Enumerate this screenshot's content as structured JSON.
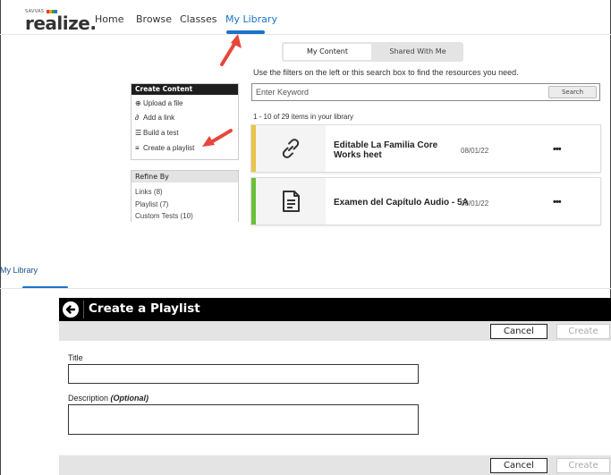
{
  "topnav": {
    "logo_small": "SAVVAS",
    "logo": "realize.",
    "items": [
      "Home",
      "Browse",
      "Classes",
      "My Library"
    ],
    "active": "My Library"
  },
  "content_tabs": [
    "My Content",
    "Shared With Me"
  ],
  "hint": "Use the filters on the left or this search box to find the resources you need.",
  "search": {
    "placeholder": "Enter Keyword",
    "button": "Search"
  },
  "result_count": "1 - 10 of 29 items in your library",
  "items": [
    {
      "title": "Editable La Familia Core Works heet",
      "date": "08/01/22",
      "more": "•••",
      "icon": "link-icon",
      "color": "#e8c547"
    },
    {
      "title": "Examen del Capítulo Audio - 5A",
      "date": "08/01/22",
      "more": "•••",
      "icon": "document-icon",
      "color": "#6cbf3a"
    }
  ],
  "create_content": {
    "header": "Create Content",
    "items": [
      {
        "label": "Upload a file",
        "icon": "upload-icon"
      },
      {
        "label": "Add a link",
        "icon": "link-icon"
      },
      {
        "label": "Build a test",
        "icon": "test-icon"
      },
      {
        "label": "Create a playlist",
        "icon": "playlist-icon"
      }
    ]
  },
  "refine": {
    "header": "Refine By",
    "items": [
      "Links (8)",
      "Playlist (7)",
      "Custom Tests (10)"
    ]
  },
  "bottom": {
    "tab": "My Library",
    "modal_title": "Create a Playlist",
    "cancel": "Cancel",
    "create": "Create",
    "title_label": "Title",
    "description_label": "Description",
    "optional": "(Optional)"
  },
  "colors": {
    "accent": "#1a73c9",
    "arrow": "#e8463c"
  }
}
